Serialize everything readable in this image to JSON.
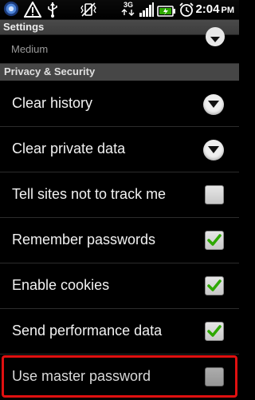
{
  "status_bar": {
    "time": "2:04",
    "time_suffix": "PM",
    "network_label": "3G",
    "left_icons": [
      "app-icon",
      "warning-icon",
      "usb-icon"
    ],
    "right_icons": [
      "vibrate-icon",
      "network-3g-icon",
      "signal-icon",
      "battery-icon",
      "alarm-icon"
    ]
  },
  "title": "Settings",
  "partial_setting": {
    "summary": "Medium"
  },
  "category": {
    "title": "Privacy & Security"
  },
  "preferences": [
    {
      "label": "Clear history",
      "widget": "dropdown"
    },
    {
      "label": "Clear private data",
      "widget": "dropdown"
    },
    {
      "label": "Tell sites not to track me",
      "widget": "checkbox",
      "checked": false
    },
    {
      "label": "Remember passwords",
      "widget": "checkbox",
      "checked": true
    },
    {
      "label": "Enable cookies",
      "widget": "checkbox",
      "checked": true
    },
    {
      "label": "Send performance data",
      "widget": "checkbox",
      "checked": true
    },
    {
      "label": "Use master password",
      "widget": "checkbox",
      "checked": false,
      "highlighted": true
    }
  ],
  "colors": {
    "check_green": "#2ea800",
    "highlight_red": "#e01010"
  }
}
